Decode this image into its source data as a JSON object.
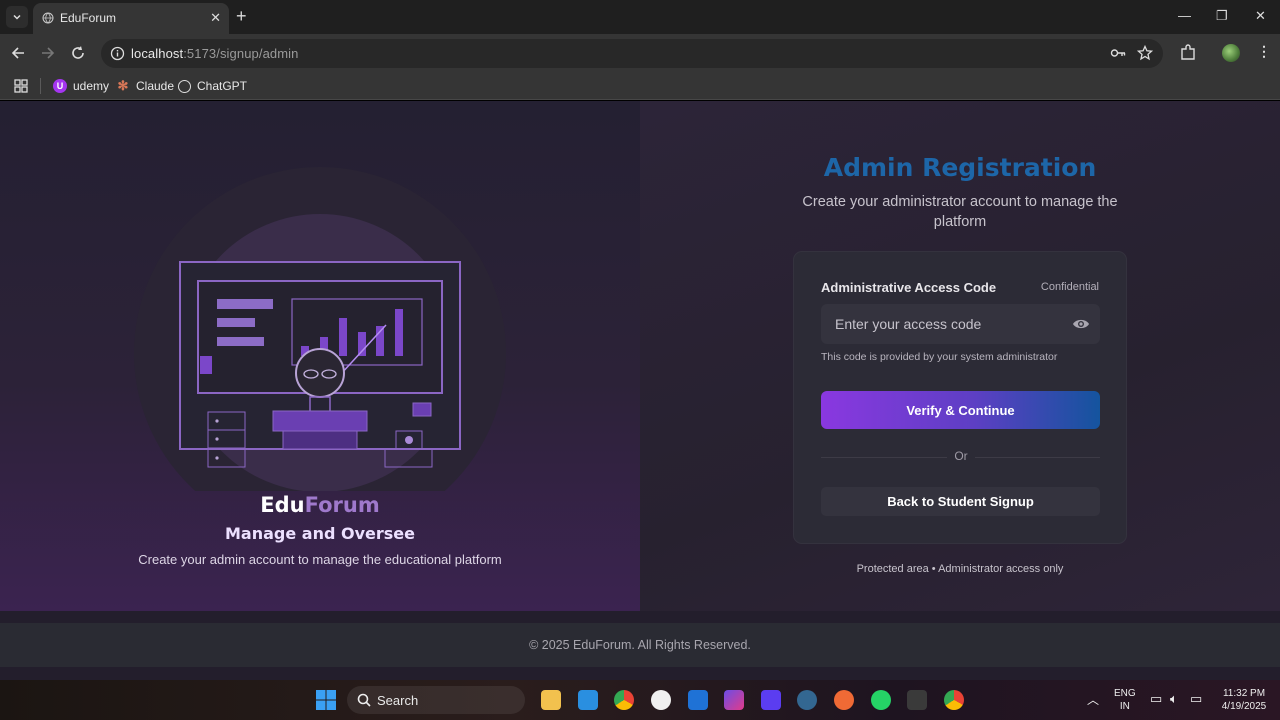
{
  "browser": {
    "tab_title": "EduForum",
    "url_host": "localhost",
    "url_rest": ":5173/signup/admin",
    "bookmarks": [
      {
        "label": "udemy",
        "icon": "udemy-icon",
        "color": "#a435f0"
      },
      {
        "label": "Claude",
        "icon": "claude-icon",
        "color": "#d97757"
      },
      {
        "label": "ChatGPT",
        "icon": "chatgpt-icon",
        "color": "#ffffff"
      }
    ]
  },
  "left": {
    "brand_part1": "Edu",
    "brand_part2": "Forum",
    "tagline": "Manage and Oversee",
    "subtagline": "Create your admin account to manage the educational platform"
  },
  "right": {
    "heading": "Admin Registration",
    "subheading": "Create your administrator account to manage the platform",
    "field_label": "Administrative Access Code",
    "field_tag": "Confidential",
    "input_placeholder": "Enter your access code",
    "hint": "This code is provided by your system administrator",
    "verify_label": "Verify & Continue",
    "or_label": "Or",
    "back_label": "Back to Student Signup",
    "protected": "Protected area • Administrator access only"
  },
  "footer": {
    "copyright": "© 2025 EduForum. All Rights Reserved."
  },
  "taskbar": {
    "search_label": "Search",
    "lang_line1": "ENG",
    "lang_line2": "IN",
    "time": "11:32 PM",
    "date": "4/19/2025"
  },
  "colors": {
    "accent_blue": "#1d66a8",
    "accent_purple": "#8a38e0",
    "brand_purple": "#9f79cc"
  }
}
